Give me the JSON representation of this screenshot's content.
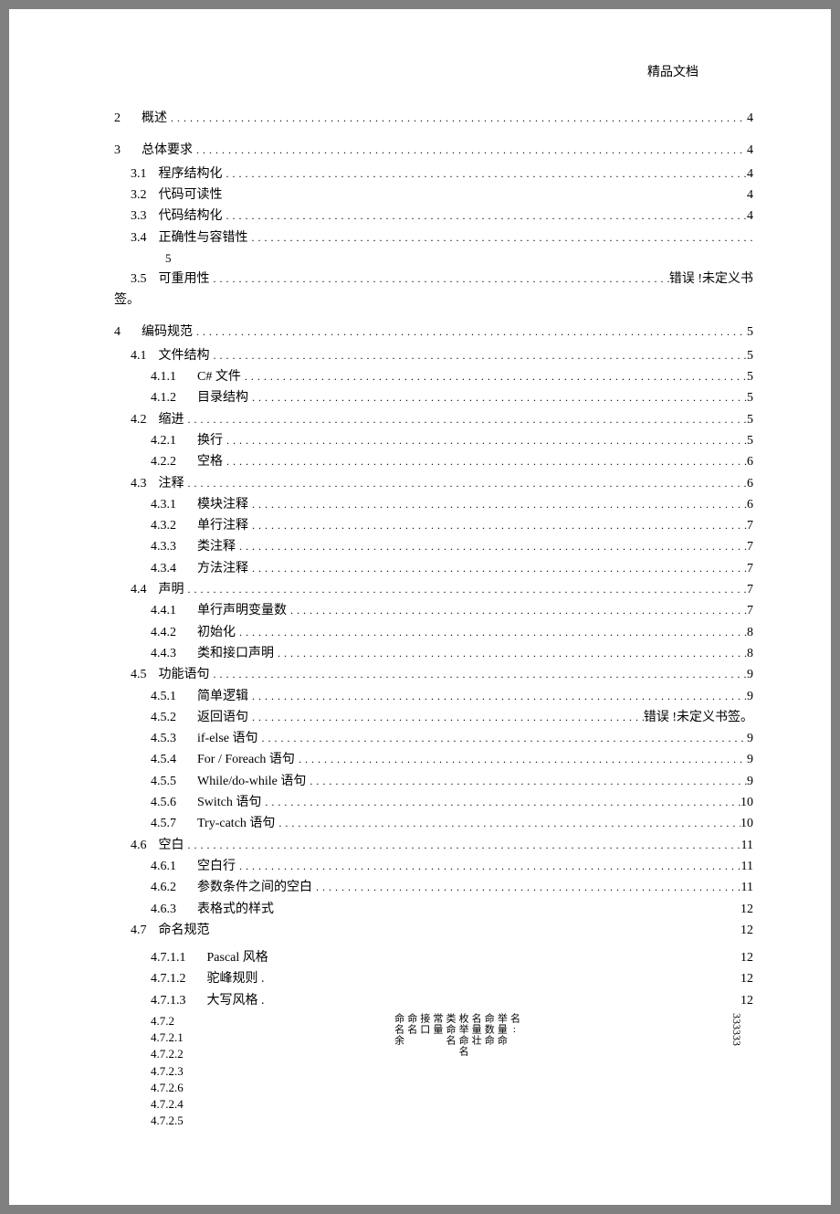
{
  "header": "精品文档",
  "toc": [
    {
      "lvl": 0,
      "num": "2",
      "label": "概述",
      "page": "4",
      "dots": true
    },
    {
      "lvl": 0,
      "num": "3",
      "label": "总体要求",
      "page": "4",
      "dots": true
    },
    {
      "lvl": 1,
      "num": "3.1",
      "label": "程序结构化",
      "page": "4",
      "dots": true
    },
    {
      "lvl": 1,
      "num": "3.2",
      "label": "代码可读性",
      "page": "4",
      "dots": false
    },
    {
      "lvl": 1,
      "num": "3.3",
      "label": "代码结构化",
      "page": "4",
      "dots": true
    },
    {
      "lvl": 1,
      "num": "3.4",
      "label": "正确性与容错性",
      "page": "",
      "dots": true,
      "sub5": "5"
    },
    {
      "lvl": 1,
      "num": "3.5",
      "label": "可重用性",
      "page": "错误   !未定义书",
      "dots": true,
      "wrap": "签。"
    },
    {
      "lvl": 0,
      "num": "4",
      "label": "编码规范",
      "page": "5",
      "dots": true
    },
    {
      "lvl": 1,
      "num": "4.1",
      "label": "文件结构",
      "page": "5",
      "dots": true
    },
    {
      "lvl": 2,
      "num": "4.1.1",
      "label": "C# 文件",
      "page": "5",
      "dots": true
    },
    {
      "lvl": 2,
      "num": "4.1.2",
      "label": "目录结构",
      "page": "5",
      "dots": true
    },
    {
      "lvl": 1,
      "num": "4.2",
      "label": "缩进",
      "page": "5",
      "dots": true
    },
    {
      "lvl": 2,
      "num": "4.2.1",
      "label": "换行",
      "page": "5",
      "dots": true
    },
    {
      "lvl": 2,
      "num": "4.2.2",
      "label": "空格",
      "page": "6",
      "dots": true
    },
    {
      "lvl": 1,
      "num": "4.3",
      "label": "注释",
      "page": "6",
      "dots": true
    },
    {
      "lvl": 2,
      "num": "4.3.1",
      "label": "模块注释",
      "page": "6",
      "dots": true
    },
    {
      "lvl": 2,
      "num": "4.3.2",
      "label": "单行注释",
      "page": "7",
      "dots": true
    },
    {
      "lvl": 2,
      "num": "4.3.3",
      "label": "类注释",
      "page": "7",
      "dots": true
    },
    {
      "lvl": 2,
      "num": "4.3.4",
      "label": "方法注释",
      "page": "7",
      "dots": true
    },
    {
      "lvl": 1,
      "num": "4.4",
      "label": "声明",
      "page": "7",
      "dots": true
    },
    {
      "lvl": 2,
      "num": "4.4.1",
      "label": "单行声明变量数",
      "page": "7",
      "dots": true
    },
    {
      "lvl": 2,
      "num": "4.4.2",
      "label": "初始化",
      "page": "8",
      "dots": true
    },
    {
      "lvl": 2,
      "num": "4.4.3",
      "label": "类和接口声明",
      "page": "8",
      "dots": true
    },
    {
      "lvl": 1,
      "num": "4.5",
      "label": "功能语句",
      "page": "9",
      "dots": true
    },
    {
      "lvl": 2,
      "num": "4.5.1",
      "label": "简单逻辑",
      "page": "9",
      "dots": true
    },
    {
      "lvl": 2,
      "num": "4.5.2",
      "label": "返回语句",
      "page": "错误   !未定义书签。",
      "dots": true
    },
    {
      "lvl": 2,
      "num": "4.5.3",
      "label": "if-else 语句",
      "page": "9",
      "dots": true
    },
    {
      "lvl": 2,
      "num": "4.5.4",
      "label": "For / Foreach 语句",
      "page": "9",
      "dots": true
    },
    {
      "lvl": 2,
      "num": "4.5.5",
      "label": "While/do-while 语句",
      "page": "9",
      "dots": true
    },
    {
      "lvl": 2,
      "num": "4.5.6",
      "label": "Switch 语句",
      "page": "10",
      "dots": true
    },
    {
      "lvl": 2,
      "num": "4.5.7",
      "label": "Try-catch 语句",
      "page": "10",
      "dots": true
    },
    {
      "lvl": 1,
      "num": "4.6",
      "label": "空白",
      "page": "11",
      "dots": true
    },
    {
      "lvl": 2,
      "num": "4.6.1",
      "label": "空白行",
      "page": "11",
      "dots": true
    },
    {
      "lvl": 2,
      "num": "4.6.2",
      "label": "参数条件之间的空白",
      "page": "11",
      "dots": true
    },
    {
      "lvl": 2,
      "num": "4.6.3",
      "label": "表格式的样式",
      "page": "12",
      "dots": false
    },
    {
      "lvl": 1,
      "num": "4.7",
      "label": "命名规范",
      "page": "12",
      "dots": false
    },
    {
      "lvl": 3,
      "num": "4.7.1.1",
      "label": "Pascal 风格",
      "page": "12",
      "dots": false,
      "top": true
    },
    {
      "lvl": 3,
      "num": "4.7.1.2",
      "label": "驼峰规则  .",
      "page": "12",
      "dots": false
    },
    {
      "lvl": 3,
      "num": "4.7.1.3",
      "label": "大写风格  .",
      "page": "12",
      "dots": false
    }
  ],
  "vertical": {
    "nums": [
      "4.7.2",
      "4.7.2.1",
      "4.7.2.2",
      "4.7.2.3",
      "4.7.2.6",
      "4.7.2.4",
      "4.7.2.5"
    ],
    "cols": [
      "名:",
      "举量命",
      "命数命",
      "名量壮",
      "枚举命名",
      "类命名",
      "常量",
      "接口",
      "命名",
      "命名余"
    ],
    "pages": "333333"
  }
}
